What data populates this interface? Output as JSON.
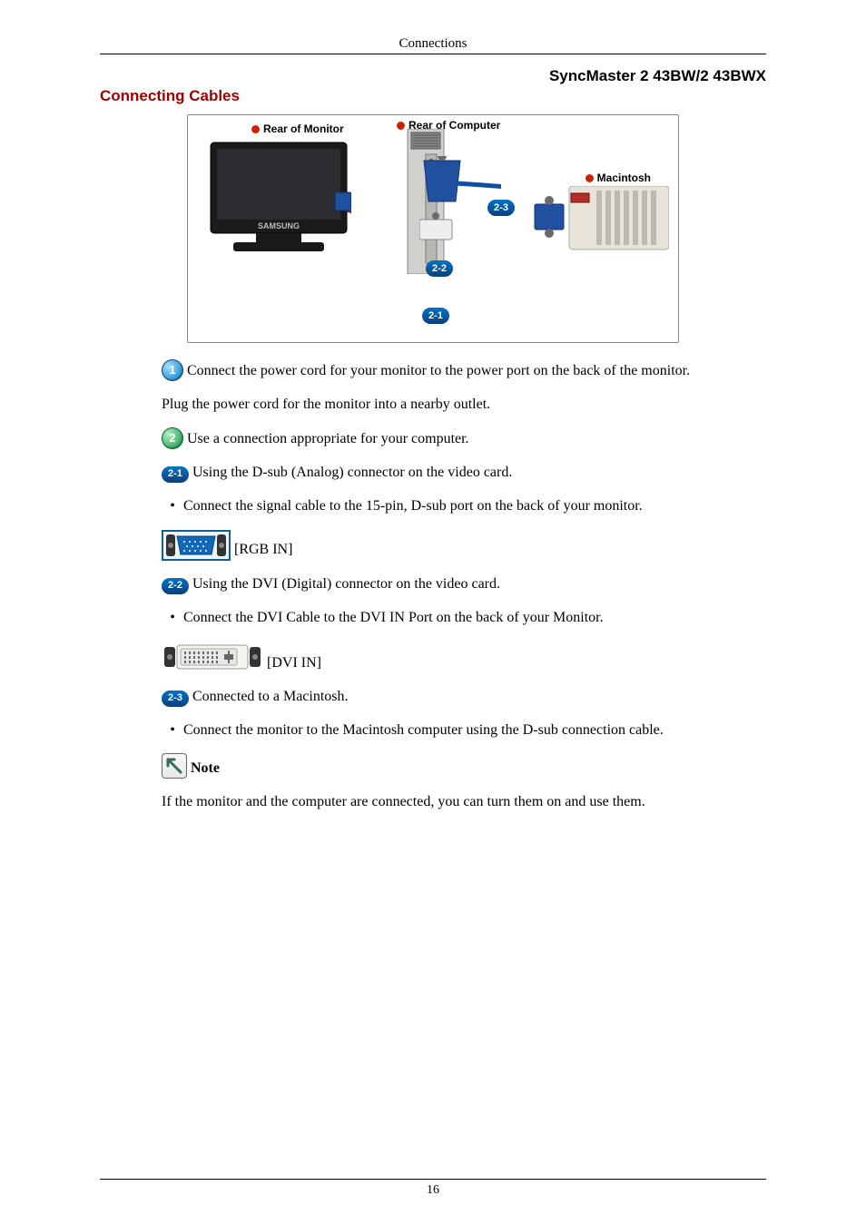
{
  "header": {
    "running": "Connections",
    "model": "SyncMaster 2  43BW/2  43BWX"
  },
  "section": {
    "title": "Connecting Cables"
  },
  "diagram": {
    "labels": {
      "monitor": "Rear of Monitor",
      "computer": "Rear of Computer",
      "mac": "Macintosh"
    },
    "callouts": {
      "c21": "2-1",
      "c22": "2-2",
      "c23": "2-3",
      "c1": "1"
    }
  },
  "steps": {
    "s1_a": "Connect the power cord for your monitor to the power port on the back of the monitor.",
    "s1_b": "Plug the power cord for the monitor into a nearby outlet.",
    "s2": "Use a connection appropriate for your computer.",
    "s21": "Using the D-sub (Analog) connector on the video card.",
    "s21_bullet": "Connect the signal cable to the 15-pin, D-sub port on the back of your monitor.",
    "port_rgb": "[RGB IN]",
    "s22": "Using the DVI (Digital) connector on the video card.",
    "s22_bullet": "Connect the DVI Cable to the DVI IN Port on the back of your Monitor.",
    "port_dvi": "[DVI IN]",
    "s23": "Connected to a Macintosh.",
    "s23_bullet": "Connect the monitor to the Macintosh computer using the D-sub connection cable."
  },
  "badges": {
    "b1": "1",
    "b2": "2",
    "b21": "2-1",
    "b22": "2-2",
    "b23": "2-3"
  },
  "note": {
    "label": "Note",
    "body": "If the monitor and the computer are connected, you can turn them on and use them."
  },
  "footer": {
    "pageno": "16"
  }
}
